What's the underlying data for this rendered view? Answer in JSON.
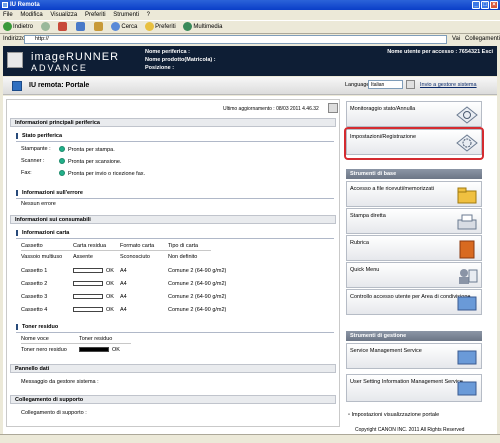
{
  "window": {
    "title": "IU Remota"
  },
  "menu": [
    "File",
    "Modifica",
    "Visualizza",
    "Preferiti",
    "Strumenti",
    "?"
  ],
  "toolbar": {
    "back": "Indietro",
    "search": "Cerca",
    "favorites": "Preferiti",
    "multimedia": "Multimedia"
  },
  "address": {
    "label": "Indirizzo",
    "value": "http://",
    "go": "Vai",
    "links": "Collegamenti"
  },
  "header": {
    "logo_line1": "imageRUNNER",
    "logo_line2": "ADVANCE",
    "device_name": "Nome periferica :",
    "product_name": "Nome prodotto(Matricola) :",
    "position": "Posizione :",
    "user": "Nome utente per accesso : 7654321",
    "logout": "Esci"
  },
  "subheader": {
    "title": "IU remota: Portale",
    "language_label": "Language:",
    "language_value": "Italian",
    "admin_link": "Invio a gestore sistema"
  },
  "main": {
    "updated": "Ultimo aggiornamento : 08/03 2011 4.46.32",
    "sec_main": "Informazioni principali periferica",
    "status_title": "Stato periferica",
    "status": [
      {
        "label": "Stampante :",
        "value": "Pronta per stampa."
      },
      {
        "label": "Scanner :",
        "value": "Pronta per scansione."
      },
      {
        "label": "Fax:",
        "value": "Pronta per invio o ricezione fax."
      }
    ],
    "error_title": "Informazioni sull'errore",
    "error_value": "Nessun errore",
    "sec_consumables": "Informazioni sui consumabili",
    "paper_title": "Informazioni carta",
    "paper_headers": [
      "Cassetto",
      "Carta residua",
      "Formato carta",
      "Tipo di carta"
    ],
    "paper_rows": [
      {
        "tray": "Vassoio multiuso",
        "remaining": "Assente",
        "ok": "",
        "size": "Sconosciuto",
        "type": "Non definito"
      },
      {
        "tray": "Cassetto 1",
        "remaining": "",
        "ok": "OK",
        "size": "A4",
        "type": "Comune 2 (64-90 g/m2)"
      },
      {
        "tray": "Cassetto 2",
        "remaining": "",
        "ok": "OK",
        "size": "A4",
        "type": "Comune 2 (64-90 g/m2)"
      },
      {
        "tray": "Cassetto 3",
        "remaining": "",
        "ok": "OK",
        "size": "A4",
        "type": "Comune 2 (64-90 g/m2)"
      },
      {
        "tray": "Cassetto 4",
        "remaining": "",
        "ok": "OK",
        "size": "A4",
        "type": "Comune 2 (64-90 g/m2)"
      }
    ],
    "toner_title": "Toner residuo",
    "toner_headers": [
      "Nome voce",
      "Toner residuo"
    ],
    "toner_rows": [
      {
        "name": "Toner nero residuo",
        "ok": "OK"
      }
    ],
    "sec_panel": "Pannello dati",
    "panel_msg": "Messaggio da gestore sistema :",
    "sec_support": "Collegamento di supporto",
    "support_msg": "Collegamento di supporto :"
  },
  "right": {
    "monitor": "Monitoraggio stato/Annulla",
    "settings": "Impostazioni/Registrazione",
    "basic_title": "Strumenti di base",
    "basic": [
      "Accesso a file ricevuti/memorizzati",
      "Stampa diretta",
      "Rubrica",
      "Quick Menu",
      "Controllo accesso utente per Area di condivisione"
    ],
    "mgmt_title": "Strumenti di gestione",
    "mgmt": [
      "Service Management Service",
      "User Setting Information Management Service"
    ],
    "display_settings": "Impostazioni visualizzazione portale"
  },
  "footer": {
    "copyright": "Copyright CANON INC. 2011 All Rights Reserved"
  },
  "colors": {
    "header_bg": "#0e1e35",
    "highlight": "#d42b30",
    "status_ok": "#22b08a"
  }
}
